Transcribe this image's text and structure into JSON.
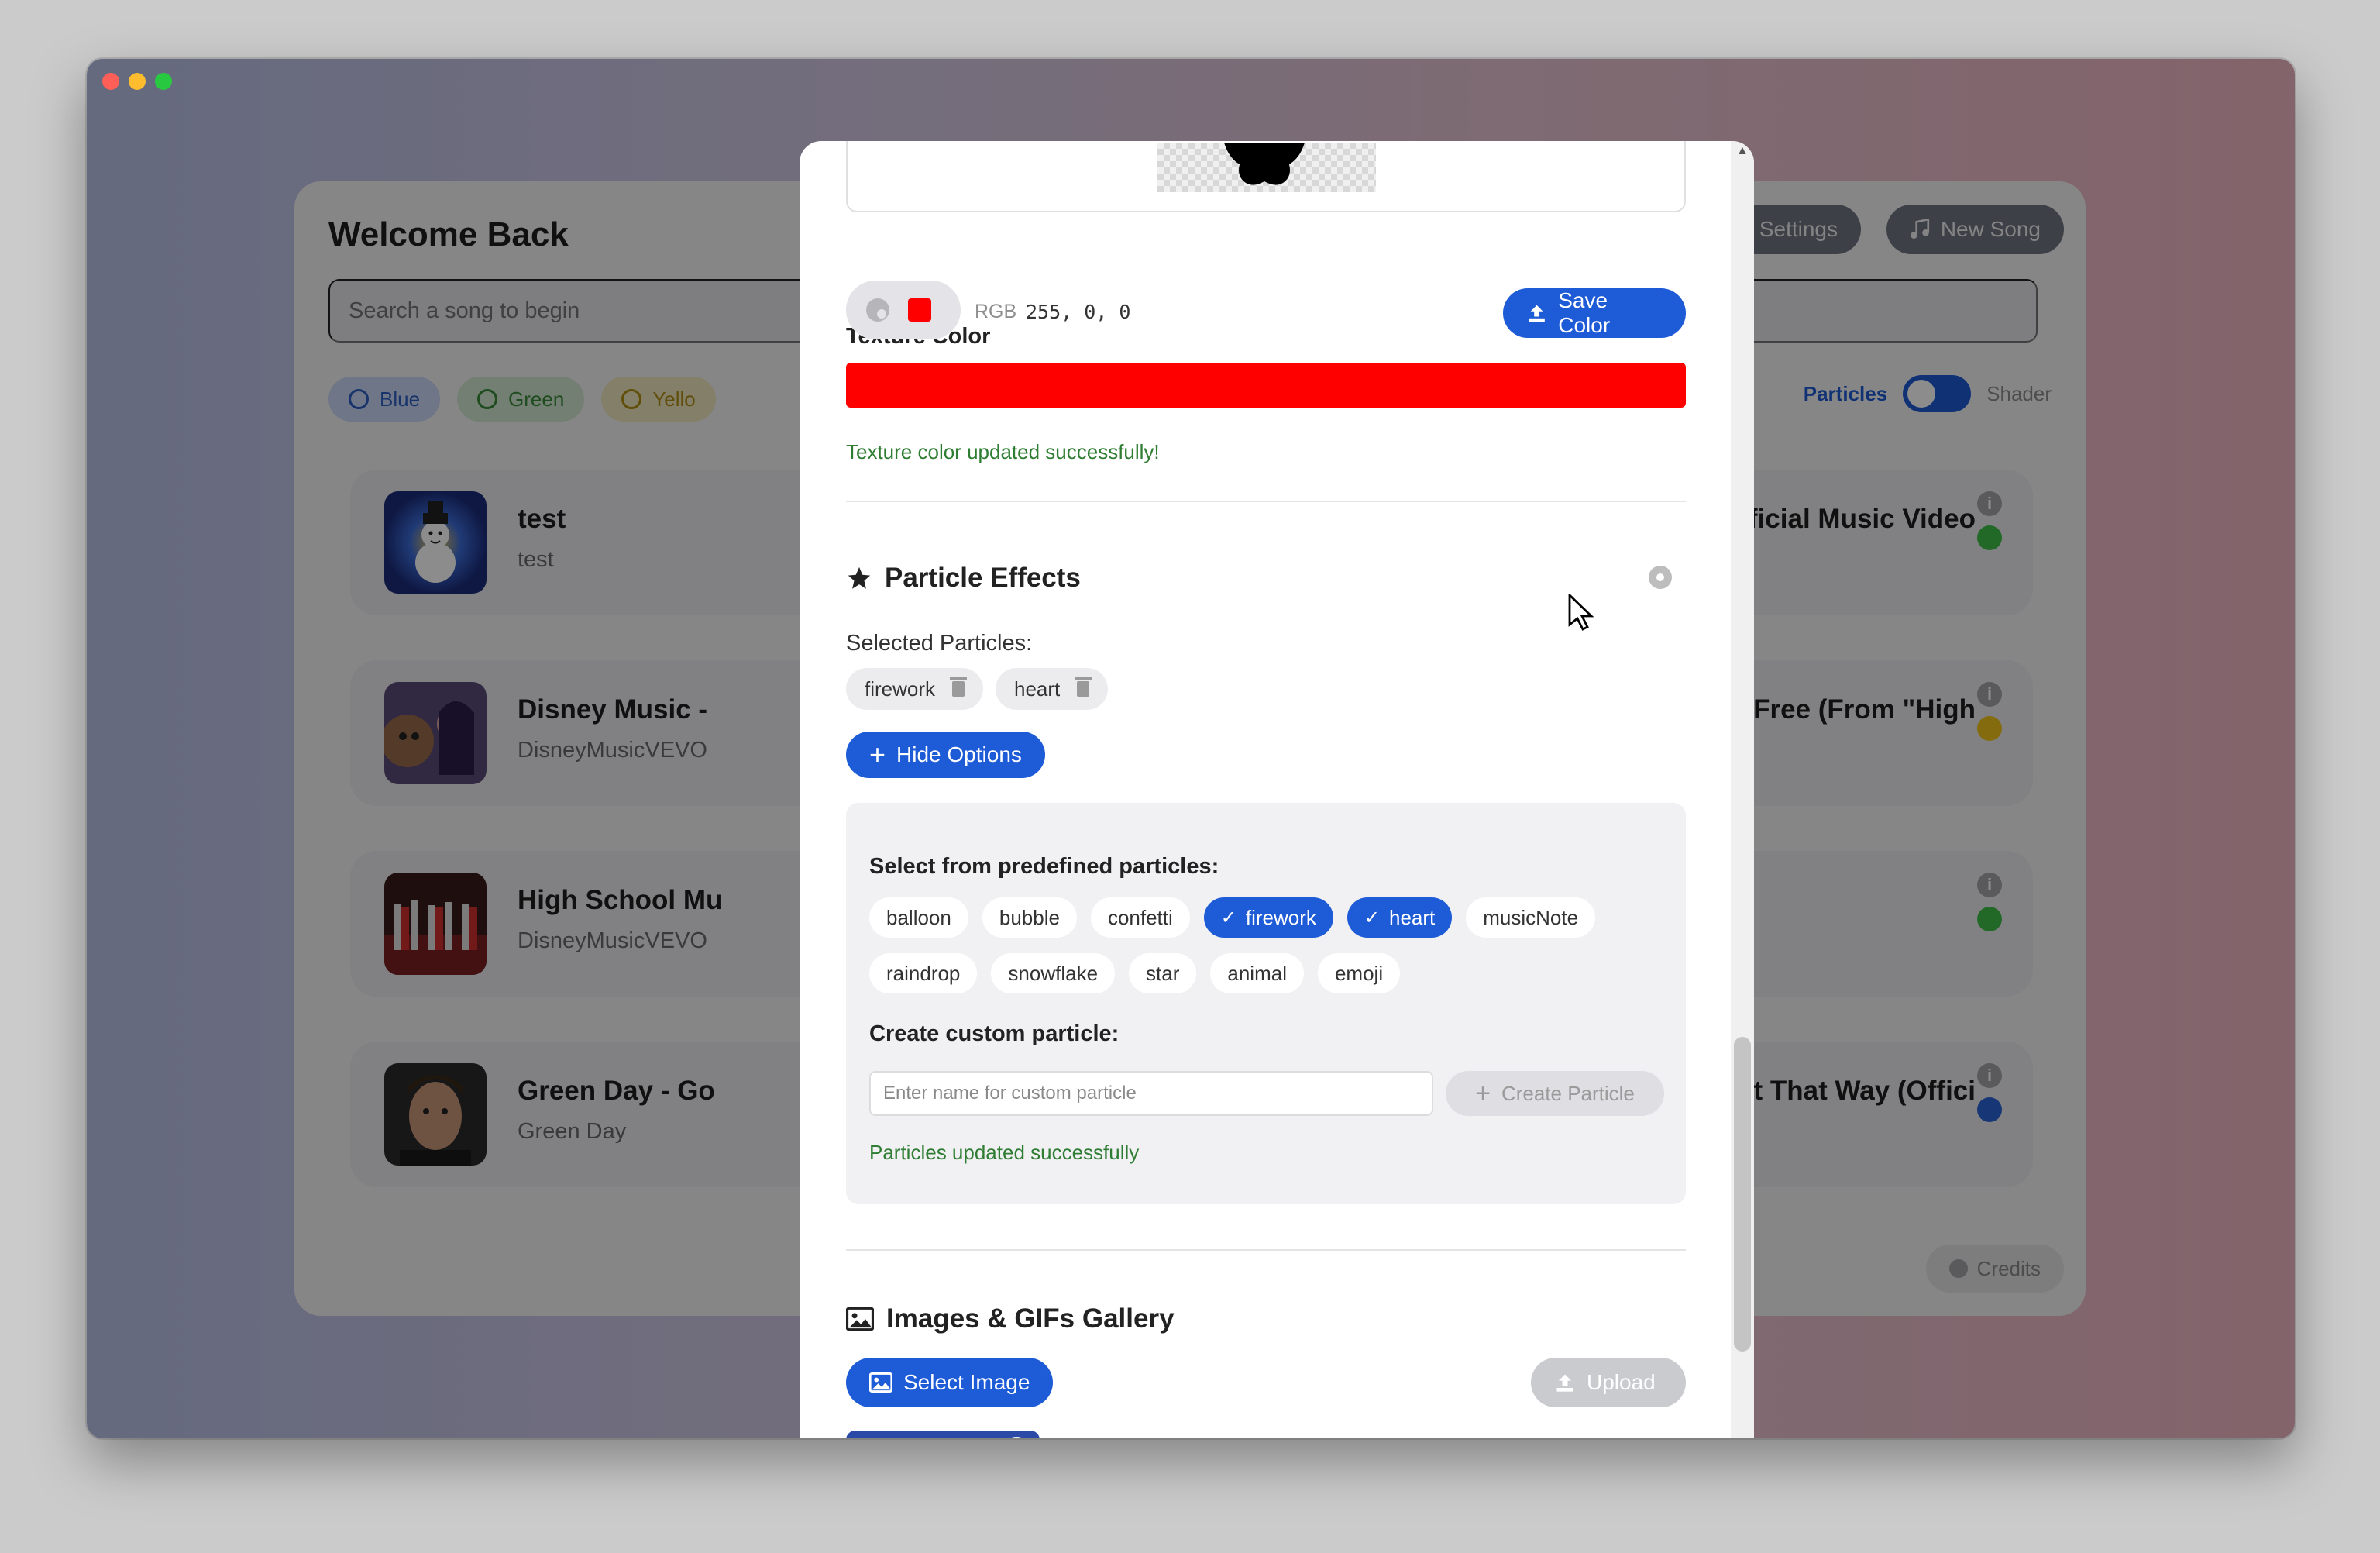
{
  "app": {
    "welcome_title": "Welcome Back",
    "search_placeholder": "Search a song to begin",
    "hue_settings_label": "Hue Settings",
    "new_song_label": "New Song",
    "filters": [
      {
        "label": "Blue"
      },
      {
        "label": "Green"
      },
      {
        "label": "Yello"
      }
    ],
    "mode_left": "Particles",
    "mode_right": "Shader",
    "credits_label": "Credits",
    "songs": [
      {
        "title": "test",
        "artist": "test",
        "right_title": "de (Official Music Video",
        "dot_color": "#3fbf4a"
      },
      {
        "title": "Disney Music -",
        "artist": "DisneyMusicVEVO",
        "right_title": "aking Free (From \"High",
        "dot_color": "#f0c419"
      },
      {
        "title": "High School Mu",
        "artist": "DisneyMusicVEVO",
        "right_title": "",
        "dot_color": "#3fbf4a"
      },
      {
        "title": "Green Day - Go",
        "artist": "Green Day",
        "right_title": "Want It That Way (Offici",
        "dot_color": "#2a63d6"
      }
    ]
  },
  "modal": {
    "texture_color": {
      "label": "Texture Color",
      "rgb_label": "RGB",
      "rgb_value": "255, 0, 0",
      "save_label": "Save Color",
      "success_text": "Texture color updated successfully!",
      "color": "#ff0000"
    },
    "particles": {
      "heading": "Particle Effects",
      "selected_label": "Selected Particles:",
      "selected": [
        "firework",
        "heart"
      ],
      "toggle_label": "Hide Options",
      "predefined_title": "Select from predefined particles:",
      "predefined_row1": [
        {
          "name": "balloon",
          "selected": false
        },
        {
          "name": "bubble",
          "selected": false
        },
        {
          "name": "confetti",
          "selected": false
        },
        {
          "name": "firework",
          "selected": true
        },
        {
          "name": "heart",
          "selected": true
        },
        {
          "name": "musicNote",
          "selected": false
        }
      ],
      "predefined_row2": [
        {
          "name": "raindrop",
          "selected": false
        },
        {
          "name": "snowflake",
          "selected": false
        },
        {
          "name": "star",
          "selected": false
        },
        {
          "name": "animal",
          "selected": false
        },
        {
          "name": "emoji",
          "selected": false
        }
      ],
      "custom_title": "Create custom particle:",
      "custom_placeholder": "Enter name for custom particle",
      "create_label": "Create Particle",
      "success_text": "Particles updated successfully"
    },
    "gallery": {
      "heading": "Images & GIFs Gallery",
      "select_label": "Select Image",
      "upload_label": "Upload"
    }
  },
  "colors": {
    "accent": "#1e5bd6",
    "success": "#2e7d32"
  }
}
